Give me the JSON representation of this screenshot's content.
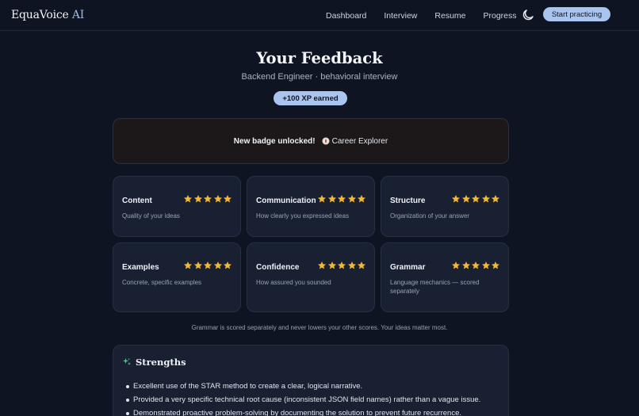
{
  "nav": {
    "brand": "EquaVoice",
    "brand_ai": "AI",
    "links": [
      "Dashboard",
      "Interview",
      "Resume",
      "Progress"
    ],
    "theme_icon": "moon-icon",
    "cta": "Start practicing"
  },
  "header": {
    "title": "Your Feedback",
    "subtitle": "Backend Engineer · behavioral interview",
    "xp": "+100 XP earned"
  },
  "badge": {
    "text": "New badge unlocked!",
    "icon": "compass-icon",
    "name": "Career Explorer"
  },
  "scores": [
    {
      "label": "Content",
      "description": "Quality of your ideas",
      "rating": 5,
      "max": 5
    },
    {
      "label": "Communication",
      "description": "How clearly you expressed ideas",
      "rating": 5,
      "max": 5
    },
    {
      "label": "Structure",
      "description": "Organization of your answer",
      "rating": 5,
      "max": 5
    },
    {
      "label": "Examples",
      "description": "Concrete, specific examples",
      "rating": 5,
      "max": 5
    },
    {
      "label": "Confidence",
      "description": "How assured you sounded",
      "rating": 5,
      "max": 5
    },
    {
      "label": "Grammar",
      "description": "Language mechanics — scored separately",
      "rating": 5,
      "max": 5
    }
  ],
  "note": "Grammar is scored separately and never lowers your other scores. Your ideas matter most.",
  "strengths": {
    "title": "Strengths",
    "icon": "sparkles-icon",
    "items": [
      "Excellent use of the STAR method to create a clear, logical narrative.",
      "Provided a very specific technical root cause (inconsistent JSON field names) rather than a vague issue.",
      "Demonstrated proactive problem-solving by documenting the solution to prevent future recurrence."
    ]
  },
  "colors": {
    "background": "#0e1422",
    "card": "#182032",
    "accent": "#a9c4ee",
    "star": "#f5b82e"
  }
}
